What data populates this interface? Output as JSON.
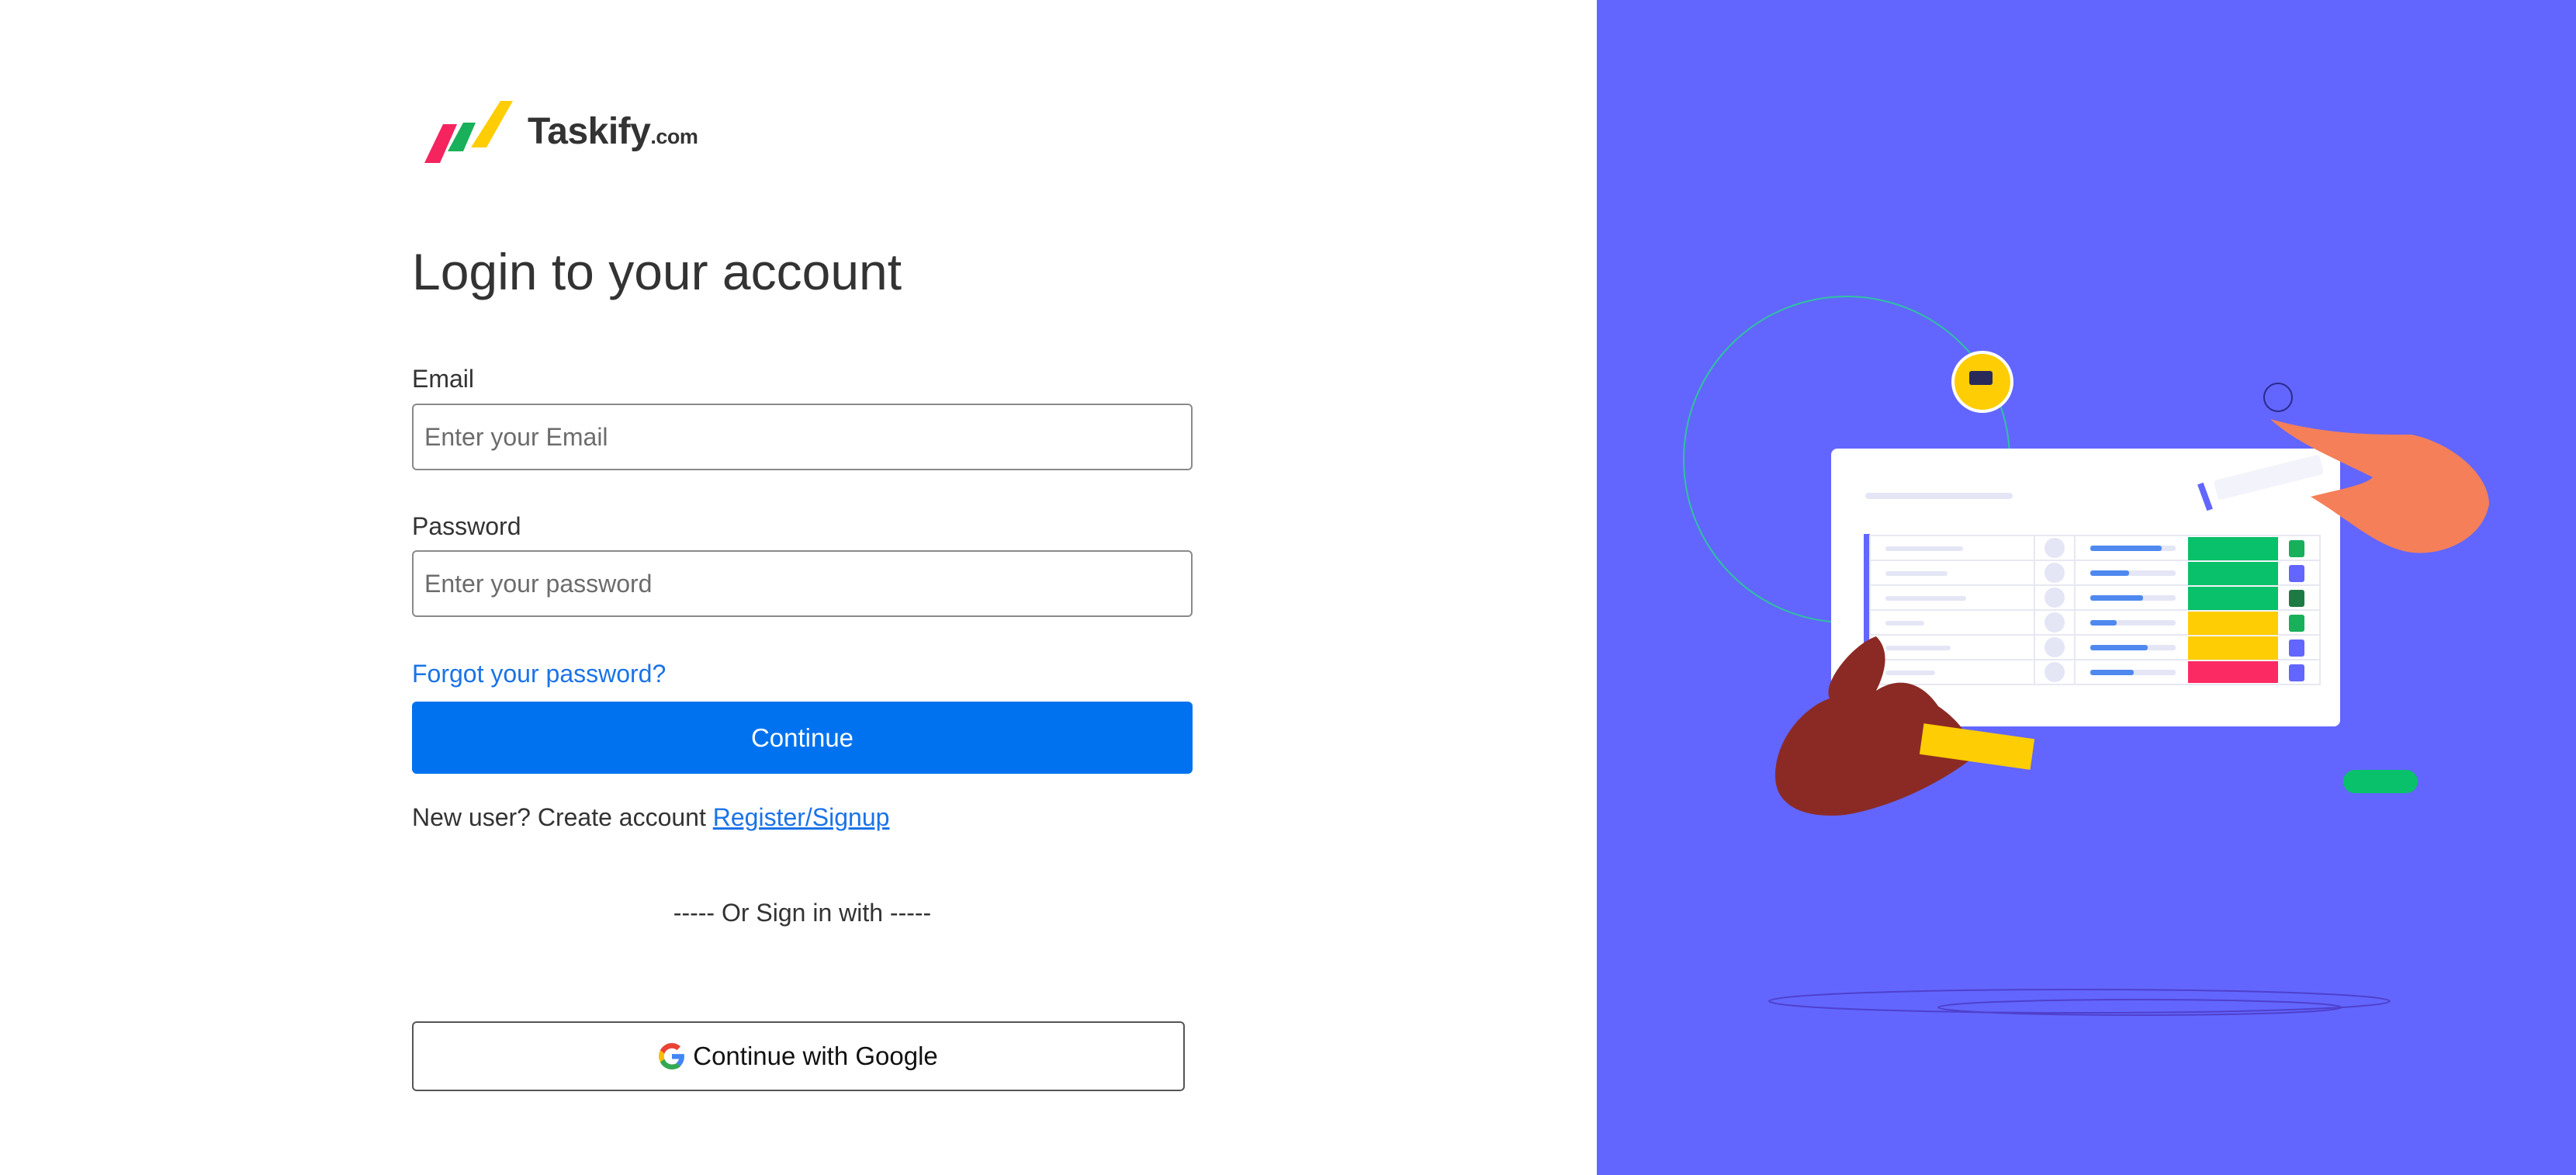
{
  "brand": {
    "name": "Taskify",
    "tld": ".com",
    "logo_colors": [
      "#f5245e",
      "#18b05a",
      "#ffcd03"
    ]
  },
  "login": {
    "title": "Login to your account",
    "email_label": "Email",
    "email_placeholder": "Enter your Email",
    "email_value": "",
    "password_label": "Password",
    "password_placeholder": "Enter your password",
    "password_value": "",
    "forgot_label": "Forgot your password?",
    "continue_label": "Continue",
    "new_user_text": "New user? Create account",
    "signup_label": "Register/Signup",
    "divider_text": "----- Or Sign in with -----",
    "google_label": "Continue with Google"
  },
  "colors": {
    "primary": "#0072ef",
    "link": "#1a73e8",
    "panel_bg": "#6266fe"
  },
  "icons": {
    "google": "google-icon",
    "logo": "taskify-logo-icon"
  }
}
